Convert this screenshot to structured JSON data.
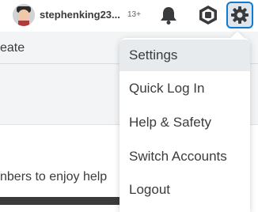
{
  "header": {
    "username": "stephenking23...",
    "age_badge": "13+",
    "icons": [
      "avatar",
      "bell-icon",
      "robux-icon",
      "gear-icon"
    ],
    "accent_color": "#0b7bd6"
  },
  "subnav": {
    "create_label": "eate"
  },
  "content": {
    "promo_text": "nbers to enjoy help"
  },
  "settings_menu": {
    "items": [
      {
        "label": "Settings",
        "active": true
      },
      {
        "label": "Quick Log In"
      },
      {
        "label": "Help & Safety"
      },
      {
        "label": "Switch Accounts"
      },
      {
        "label": "Logout"
      }
    ]
  }
}
